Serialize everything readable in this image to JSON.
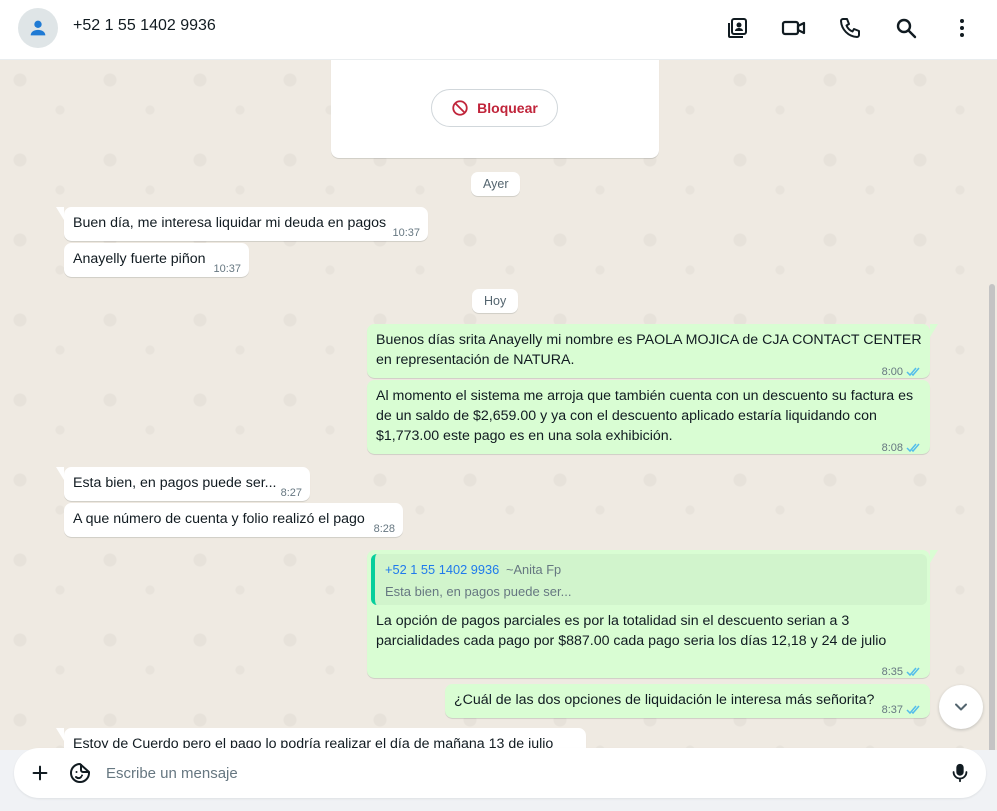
{
  "header": {
    "contact_name": "+52 1 55 1402 9936"
  },
  "card": {
    "block_label": "Bloquear"
  },
  "dates": {
    "yesterday": "Ayer",
    "today": "Hoy"
  },
  "messages": [
    {
      "dir": "in",
      "text": "Buen día, me interesa liquidar mi deuda en pagos",
      "time": "10:37"
    },
    {
      "dir": "in",
      "text": "Anayelly fuerte piñon",
      "time": "10:37"
    },
    {
      "dir": "out",
      "text_lines": [
        "Buenos días srita Anayelly mi nombre es PAOLA MOJICA de CJA CONTACT CENTER",
        "en representación de NATURA."
      ],
      "time": "8:00",
      "status": "read"
    },
    {
      "dir": "out",
      "text_lines": [
        "Al momento el sistema me arroja que también cuenta con un descuento su factura es",
        "de un saldo de $2,659.00 y ya con el descuento aplicado estaría liquidando con",
        "$1,773.00 este pago es en una sola exhibición."
      ],
      "time": "8:08",
      "status": "read"
    },
    {
      "dir": "in",
      "text": "Esta bien, en pagos puede ser...",
      "time": "8:27"
    },
    {
      "dir": "in",
      "text": "A que número de cuenta y folio realizó el pago",
      "time": "8:28"
    },
    {
      "dir": "out",
      "quote": {
        "author": "+52 1 55 1402 9936",
        "nick": "~Anita Fp",
        "text": "Esta bien, en pagos puede ser..."
      },
      "text_lines": [
        "La opción de pagos parciales es por la totalidad sin el descuento serian a 3",
        "parcialidades cada pago por $887.00 cada pago seria los días 12,18 y 24 de julio"
      ],
      "time": "8:35",
      "status": "read"
    },
    {
      "dir": "out",
      "text": "¿Cuál de las dos opciones de liquidación le interesa más señorita?",
      "time": "8:37",
      "status": "read"
    },
    {
      "dir": "in",
      "text": "Estoy de Cuerdo pero el pago lo podría realizar el día de mañana 13 de julio"
    }
  ],
  "composer": {
    "placeholder": "Escribe un mensaje"
  },
  "colors": {
    "outgoing_bubble": "#d9fdd3",
    "incoming_bubble": "#ffffff",
    "read_tick": "#53bdeb",
    "block_red": "#c0243a",
    "chat_background": "#efeae2"
  },
  "icons": {
    "header": [
      "contact-card-icon",
      "video-call-icon",
      "phone-icon",
      "search-icon",
      "menu-dots-icon"
    ],
    "composer": [
      "plus-icon",
      "sticker-icon",
      "microphone-icon"
    ]
  }
}
